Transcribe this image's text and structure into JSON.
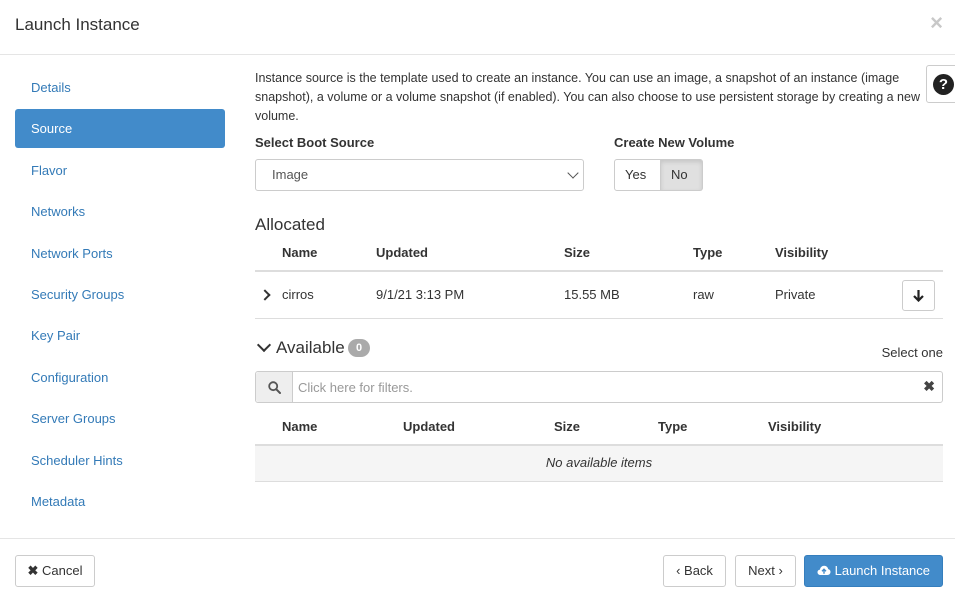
{
  "modal": {
    "title": "Launch Instance",
    "close": "×"
  },
  "nav": {
    "items": [
      {
        "label": "Details"
      },
      {
        "label": "Source"
      },
      {
        "label": "Flavor"
      },
      {
        "label": "Networks"
      },
      {
        "label": "Network Ports"
      },
      {
        "label": "Security Groups"
      },
      {
        "label": "Key Pair"
      },
      {
        "label": "Configuration"
      },
      {
        "label": "Server Groups"
      },
      {
        "label": "Scheduler Hints"
      },
      {
        "label": "Metadata"
      }
    ],
    "active": "Source"
  },
  "source": {
    "help_text": "Instance source is the template used to create an instance. You can use an image, a snapshot of an instance (image snapshot), a volume or a volume snapshot (if enabled). You can also choose to use persistent storage by creating a new volume.",
    "help_icon": "question-circle-icon",
    "boot_source_label": "Select Boot Source",
    "boot_source_value": "Image",
    "create_volume_label": "Create New Volume",
    "yes_label": "Yes",
    "no_label": "No",
    "create_volume_selected": "No"
  },
  "allocated": {
    "heading": "Allocated",
    "columns": [
      "Name",
      "Updated",
      "Size",
      "Type",
      "Visibility"
    ],
    "rows": [
      {
        "name": "cirros",
        "updated": "9/1/21 3:13 PM",
        "size": "15.55 MB",
        "type": "raw",
        "visibility": "Private"
      }
    ]
  },
  "available": {
    "heading": "Available",
    "count": "0",
    "select_one": "Select one",
    "filter_placeholder": "Click here for filters.",
    "clear": "✖",
    "columns": [
      "Name",
      "Updated",
      "Size",
      "Type",
      "Visibility"
    ],
    "empty_text": "No available items"
  },
  "footer": {
    "cancel": "Cancel",
    "back": "Back",
    "next": "Next",
    "launch": "Launch Instance"
  },
  "colors": {
    "primary": "#428bca",
    "link": "#337ab7"
  }
}
